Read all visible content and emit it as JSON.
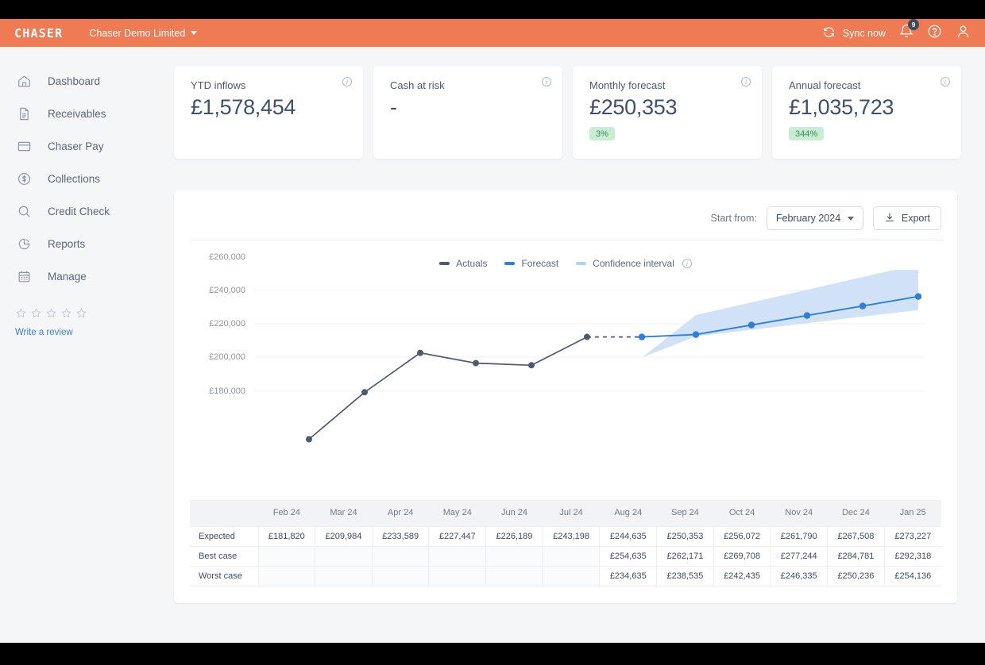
{
  "topbar": {
    "brand": "CHASER",
    "company": "Chaser Demo Limited",
    "sync_label": "Sync now",
    "notification_count": "9"
  },
  "sidebar": {
    "items": [
      {
        "label": "Dashboard",
        "icon": "home-icon"
      },
      {
        "label": "Receivables",
        "icon": "document-icon"
      },
      {
        "label": "Chaser Pay",
        "icon": "card-icon"
      },
      {
        "label": "Collections",
        "icon": "dollar-circle-icon"
      },
      {
        "label": "Credit Check",
        "icon": "search-icon"
      },
      {
        "label": "Reports",
        "icon": "pie-chart-icon"
      },
      {
        "label": "Manage",
        "icon": "calendar-icon"
      }
    ],
    "review_link": "Write a review",
    "star_count": 5
  },
  "kpis": [
    {
      "title": "YTD inflows",
      "value": "£1,578,454",
      "pill": null
    },
    {
      "title": "Cash at risk",
      "value": "-",
      "pill": null
    },
    {
      "title": "Monthly forecast",
      "value": "£250,353",
      "pill": "3%"
    },
    {
      "title": "Annual forecast",
      "value": "£1,035,723",
      "pill": "344%"
    }
  ],
  "chart_toolbar": {
    "start_from_label": "Start from:",
    "selected_period": "February 2024",
    "export_label": "Export"
  },
  "legend": [
    {
      "label": "Actuals",
      "color": "#4e5b6e"
    },
    {
      "label": "Forecast",
      "color": "#2f7ed8"
    },
    {
      "label": "Confidence interval",
      "color": "#b4d2f2"
    }
  ],
  "colors": {
    "brand_orange": "#ef7b55",
    "actuals": "#4e5b6e",
    "forecast": "#2f7ed8",
    "confidence": "#cfe0f5",
    "pill_bg": "#c8ecd4",
    "pill_text": "#3a8a58",
    "link": "#3c7fd4"
  },
  "chart_data": {
    "type": "line",
    "title": "",
    "xlabel": "",
    "ylabel": "",
    "ylim": [
      170000,
      276000
    ],
    "yticks": [
      180000,
      200000,
      220000,
      240000,
      260000
    ],
    "ytick_labels": [
      "£180,000",
      "£200,000",
      "£220,000",
      "£240,000",
      "£260,000"
    ],
    "grid": true,
    "legend_position": "top-center",
    "categories": [
      "Feb 24",
      "Mar 24",
      "Apr 24",
      "May 24",
      "Jun 24",
      "Jul 24",
      "Aug 24",
      "Sep 24",
      "Oct 24",
      "Nov 24",
      "Dec 24",
      "Jan 25"
    ],
    "series": [
      {
        "name": "Actuals",
        "color": "#4e5b6e",
        "values": [
          181820,
          209984,
          233589,
          227447,
          226189,
          243198,
          null,
          null,
          null,
          null,
          null,
          null
        ]
      },
      {
        "name": "Forecast",
        "color": "#2f7ed8",
        "values": [
          null,
          null,
          null,
          null,
          null,
          243198,
          244635,
          250353,
          256072,
          261790,
          267508,
          273227
        ]
      },
      {
        "name": "Confidence interval upper (Best case)",
        "color": "#cfe0f5",
        "values": [
          null,
          null,
          null,
          null,
          null,
          243198,
          254635,
          262171,
          269708,
          277244,
          284781,
          292318
        ]
      },
      {
        "name": "Confidence interval lower (Worst case)",
        "color": "#cfe0f5",
        "values": [
          null,
          null,
          null,
          null,
          null,
          243198,
          234635,
          238535,
          242435,
          246335,
          250236,
          254136
        ]
      }
    ]
  },
  "table": {
    "columns": [
      "",
      "Feb 24",
      "Mar 24",
      "Apr 24",
      "May 24",
      "Jun 24",
      "Jul 24",
      "Aug 24",
      "Sep 24",
      "Oct 24",
      "Nov 24",
      "Dec 24",
      "Jan 25"
    ],
    "rows": [
      {
        "label": "Expected",
        "cells": [
          "£181,820",
          "£209,984",
          "£233,589",
          "£227,447",
          "£226,189",
          "£243,198",
          "£244,635",
          "£250,353",
          "£256,072",
          "£261,790",
          "£267,508",
          "£273,227"
        ]
      },
      {
        "label": "Best case",
        "cells": [
          "",
          "",
          "",
          "",
          "",
          "",
          "£254,635",
          "£262,171",
          "£269,708",
          "£277,244",
          "£284,781",
          "£292,318"
        ]
      },
      {
        "label": "Worst case",
        "cells": [
          "",
          "",
          "",
          "",
          "",
          "",
          "£234,635",
          "£238,535",
          "£242,435",
          "£246,335",
          "£250,236",
          "£254,136"
        ]
      }
    ]
  }
}
